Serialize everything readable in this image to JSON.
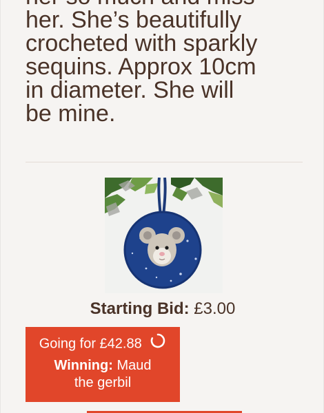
{
  "description": {
    "lines": [
      "her so much and miss",
      "her. She’s beautifully",
      "crocheted with sparkly",
      "sequins. Approx 10cm",
      "in diameter. She will",
      "be mine."
    ]
  },
  "product": {
    "image_icon": "crochet-mouse-ornament",
    "starting_bid_label": "Starting Bid:",
    "starting_bid_value": "£3.00"
  },
  "bid": {
    "going_for": "Going for £42.88",
    "winning_label": "Winning:",
    "winner_line1": "Maud",
    "winner_line2": "the gerbil",
    "spinner_icon": "loading-spinner"
  },
  "colors": {
    "accent": "#e1462a",
    "text": "#4a3328",
    "background": "#f6f4f2"
  }
}
